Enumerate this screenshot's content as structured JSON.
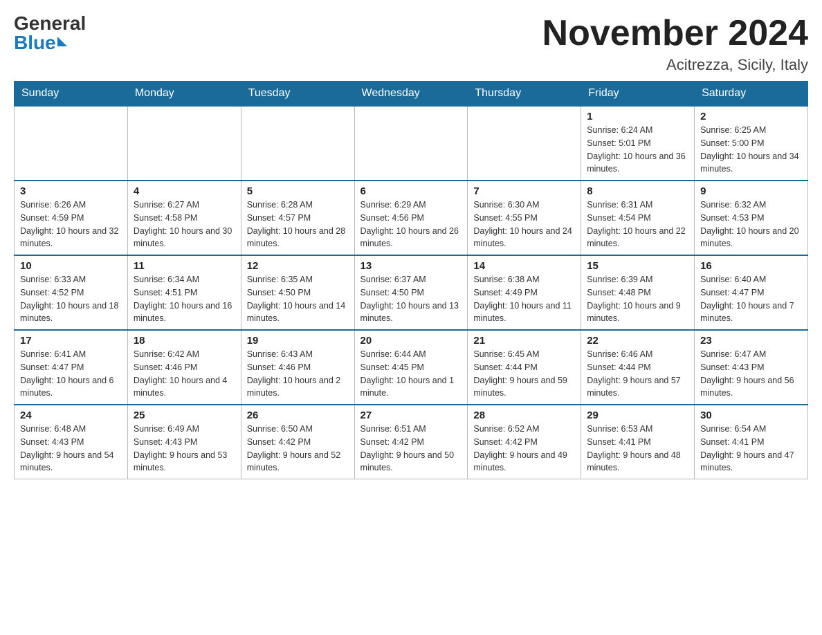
{
  "logo": {
    "general": "General",
    "blue": "Blue"
  },
  "header": {
    "month_year": "November 2024",
    "location": "Acitrezza, Sicily, Italy"
  },
  "weekdays": [
    "Sunday",
    "Monday",
    "Tuesday",
    "Wednesday",
    "Thursday",
    "Friday",
    "Saturday"
  ],
  "weeks": [
    {
      "days": [
        {
          "num": "",
          "info": ""
        },
        {
          "num": "",
          "info": ""
        },
        {
          "num": "",
          "info": ""
        },
        {
          "num": "",
          "info": ""
        },
        {
          "num": "",
          "info": ""
        },
        {
          "num": "1",
          "info": "Sunrise: 6:24 AM\nSunset: 5:01 PM\nDaylight: 10 hours and 36 minutes."
        },
        {
          "num": "2",
          "info": "Sunrise: 6:25 AM\nSunset: 5:00 PM\nDaylight: 10 hours and 34 minutes."
        }
      ]
    },
    {
      "days": [
        {
          "num": "3",
          "info": "Sunrise: 6:26 AM\nSunset: 4:59 PM\nDaylight: 10 hours and 32 minutes."
        },
        {
          "num": "4",
          "info": "Sunrise: 6:27 AM\nSunset: 4:58 PM\nDaylight: 10 hours and 30 minutes."
        },
        {
          "num": "5",
          "info": "Sunrise: 6:28 AM\nSunset: 4:57 PM\nDaylight: 10 hours and 28 minutes."
        },
        {
          "num": "6",
          "info": "Sunrise: 6:29 AM\nSunset: 4:56 PM\nDaylight: 10 hours and 26 minutes."
        },
        {
          "num": "7",
          "info": "Sunrise: 6:30 AM\nSunset: 4:55 PM\nDaylight: 10 hours and 24 minutes."
        },
        {
          "num": "8",
          "info": "Sunrise: 6:31 AM\nSunset: 4:54 PM\nDaylight: 10 hours and 22 minutes."
        },
        {
          "num": "9",
          "info": "Sunrise: 6:32 AM\nSunset: 4:53 PM\nDaylight: 10 hours and 20 minutes."
        }
      ]
    },
    {
      "days": [
        {
          "num": "10",
          "info": "Sunrise: 6:33 AM\nSunset: 4:52 PM\nDaylight: 10 hours and 18 minutes."
        },
        {
          "num": "11",
          "info": "Sunrise: 6:34 AM\nSunset: 4:51 PM\nDaylight: 10 hours and 16 minutes."
        },
        {
          "num": "12",
          "info": "Sunrise: 6:35 AM\nSunset: 4:50 PM\nDaylight: 10 hours and 14 minutes."
        },
        {
          "num": "13",
          "info": "Sunrise: 6:37 AM\nSunset: 4:50 PM\nDaylight: 10 hours and 13 minutes."
        },
        {
          "num": "14",
          "info": "Sunrise: 6:38 AM\nSunset: 4:49 PM\nDaylight: 10 hours and 11 minutes."
        },
        {
          "num": "15",
          "info": "Sunrise: 6:39 AM\nSunset: 4:48 PM\nDaylight: 10 hours and 9 minutes."
        },
        {
          "num": "16",
          "info": "Sunrise: 6:40 AM\nSunset: 4:47 PM\nDaylight: 10 hours and 7 minutes."
        }
      ]
    },
    {
      "days": [
        {
          "num": "17",
          "info": "Sunrise: 6:41 AM\nSunset: 4:47 PM\nDaylight: 10 hours and 6 minutes."
        },
        {
          "num": "18",
          "info": "Sunrise: 6:42 AM\nSunset: 4:46 PM\nDaylight: 10 hours and 4 minutes."
        },
        {
          "num": "19",
          "info": "Sunrise: 6:43 AM\nSunset: 4:46 PM\nDaylight: 10 hours and 2 minutes."
        },
        {
          "num": "20",
          "info": "Sunrise: 6:44 AM\nSunset: 4:45 PM\nDaylight: 10 hours and 1 minute."
        },
        {
          "num": "21",
          "info": "Sunrise: 6:45 AM\nSunset: 4:44 PM\nDaylight: 9 hours and 59 minutes."
        },
        {
          "num": "22",
          "info": "Sunrise: 6:46 AM\nSunset: 4:44 PM\nDaylight: 9 hours and 57 minutes."
        },
        {
          "num": "23",
          "info": "Sunrise: 6:47 AM\nSunset: 4:43 PM\nDaylight: 9 hours and 56 minutes."
        }
      ]
    },
    {
      "days": [
        {
          "num": "24",
          "info": "Sunrise: 6:48 AM\nSunset: 4:43 PM\nDaylight: 9 hours and 54 minutes."
        },
        {
          "num": "25",
          "info": "Sunrise: 6:49 AM\nSunset: 4:43 PM\nDaylight: 9 hours and 53 minutes."
        },
        {
          "num": "26",
          "info": "Sunrise: 6:50 AM\nSunset: 4:42 PM\nDaylight: 9 hours and 52 minutes."
        },
        {
          "num": "27",
          "info": "Sunrise: 6:51 AM\nSunset: 4:42 PM\nDaylight: 9 hours and 50 minutes."
        },
        {
          "num": "28",
          "info": "Sunrise: 6:52 AM\nSunset: 4:42 PM\nDaylight: 9 hours and 49 minutes."
        },
        {
          "num": "29",
          "info": "Sunrise: 6:53 AM\nSunset: 4:41 PM\nDaylight: 9 hours and 48 minutes."
        },
        {
          "num": "30",
          "info": "Sunrise: 6:54 AM\nSunset: 4:41 PM\nDaylight: 9 hours and 47 minutes."
        }
      ]
    }
  ]
}
